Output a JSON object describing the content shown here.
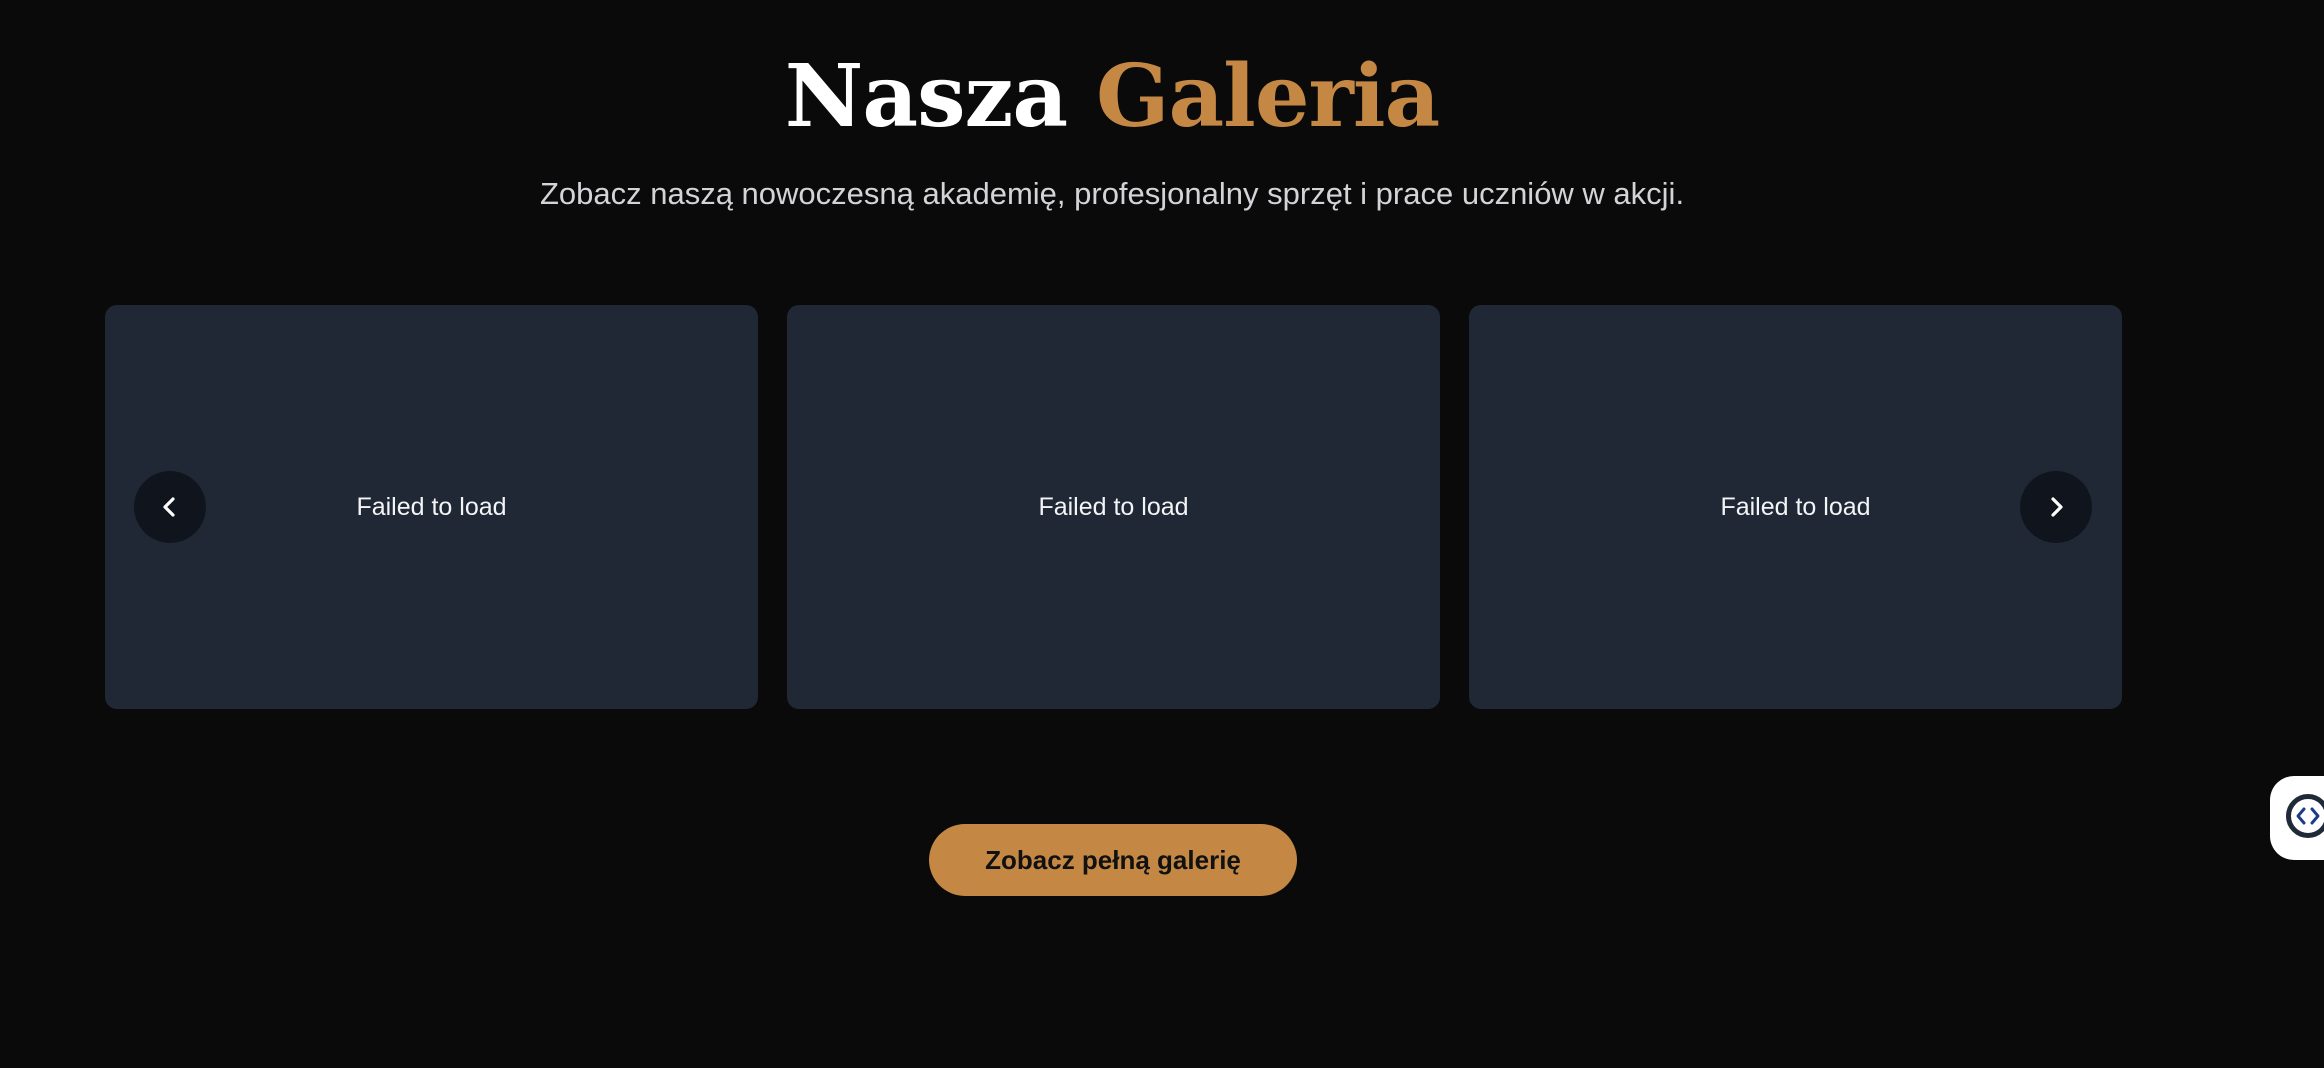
{
  "gallery": {
    "title_main": "Nasza",
    "title_accent": "Galeria",
    "subtitle": "Zobacz naszą nowoczesną akademię, profesjonalny sprzęt i prace uczniów w akcji.",
    "cards": [
      {
        "label": "Failed to load"
      },
      {
        "label": "Failed to load"
      },
      {
        "label": "Failed to load"
      }
    ],
    "cta_label": "Zobacz pełną galerię"
  },
  "icons": {
    "prev": "chevron-left-icon",
    "next": "chevron-right-icon",
    "widget": "code-brackets-icon"
  },
  "colors": {
    "background": "#0a0a0a",
    "accent": "#c48844",
    "card": "#202836",
    "nav_button": "#10151d",
    "subtitle": "#d4d4d8"
  }
}
